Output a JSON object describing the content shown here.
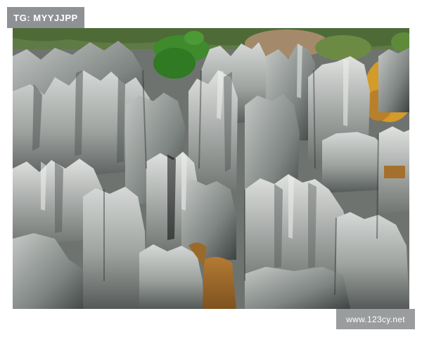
{
  "watermarks": {
    "top_left": "TG: MYYJJPP",
    "bottom_right": "www.123cy.net"
  },
  "photo": {
    "colors": {
      "rock_light": "#c9ccca",
      "rock_mid": "#8e9390",
      "rock_dark": "#4a4f4d",
      "foliage": "#3f8a2c",
      "autumn_tree": "#d49a2a",
      "soil": "#a5702d"
    }
  }
}
